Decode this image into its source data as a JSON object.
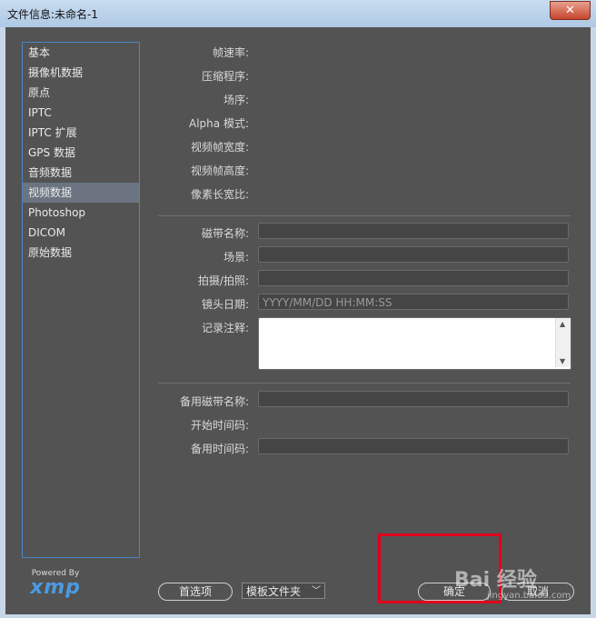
{
  "window": {
    "title": "文件信息:未命名-1",
    "close": "✕"
  },
  "sidebar": {
    "items": [
      {
        "label": "基本"
      },
      {
        "label": "摄像机数据"
      },
      {
        "label": "原点"
      },
      {
        "label": "IPTC"
      },
      {
        "label": "IPTC 扩展"
      },
      {
        "label": "GPS 数据"
      },
      {
        "label": "音频数据"
      },
      {
        "label": "视频数据"
      },
      {
        "label": "Photoshop"
      },
      {
        "label": "DICOM"
      },
      {
        "label": "原始数据"
      }
    ],
    "active_index": 7
  },
  "video_info": {
    "frame_rate_label": "帧速率:",
    "compressor_label": "压缩程序:",
    "field_order_label": "场序:",
    "alpha_mode_label": "Alpha 模式:",
    "frame_width_label": "视频帧宽度:",
    "frame_height_label": "视频帧高度:",
    "pixel_aspect_label": "像素长宽比:"
  },
  "tape": {
    "tape_name_label": "磁带名称:",
    "scene_label": "场景:",
    "shot_label": "拍摄/拍照:",
    "shot_date_label": "镜头日期:",
    "shot_date_placeholder": "YYYY/MM/DD HH:MM:SS",
    "log_comment_label": "记录注释:"
  },
  "alt": {
    "alt_tape_label": "备用磁带名称:",
    "start_timecode_label": "开始时间码:",
    "alt_timecode_label": "备用时间码:"
  },
  "footer": {
    "powered_by": "Powered By",
    "xmp_logo": "xmp",
    "prefs_button": "首选项",
    "template_folder": "模板文件夹",
    "ok_button": "确定",
    "cancel_button": "取消"
  },
  "watermark": {
    "brand": "Bai 经验",
    "url": "jingyan.baidu.com"
  },
  "colors": {
    "accent": "#4a86c5",
    "highlight": "#e0001b"
  }
}
